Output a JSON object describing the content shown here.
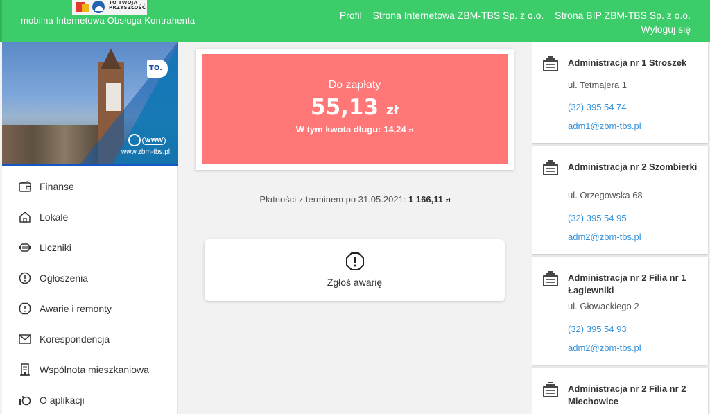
{
  "header": {
    "logo_line1": "TO TWOJA",
    "logo_line2": "PRZYSZŁOŚĆ",
    "subtitle": "mobilna Internetowa Obsługa Kontrahenta",
    "nav": {
      "profile": "Profil",
      "website": "Strona Internetowa ZBM-TBS Sp. z o.o.",
      "bip": "Strona BIP ZBM-TBS Sp. z o.o.",
      "logout": "Wyloguj się"
    }
  },
  "banner": {
    "badge": "TO.",
    "www_label": "WWW",
    "url": "www.zbm-tbs.pl"
  },
  "sidebar": {
    "items": [
      {
        "label": "Finanse",
        "icon": "wallet-icon"
      },
      {
        "label": "Lokale",
        "icon": "home-icon"
      },
      {
        "label": "Liczniki",
        "icon": "meter-icon"
      },
      {
        "label": "Ogłoszenia",
        "icon": "announcement-icon"
      },
      {
        "label": "Awarie i remonty",
        "icon": "alert-octagon-icon"
      },
      {
        "label": "Korespondencja",
        "icon": "envelope-icon"
      },
      {
        "label": "Wspólnota mieszkaniowa",
        "icon": "building-icon"
      },
      {
        "label": "O aplikacji",
        "icon": "info-icon"
      }
    ]
  },
  "payment": {
    "title": "Do zapłaty",
    "amount": "55,13",
    "currency": "zł",
    "debt_label": "W tym kwota długu: 14,24",
    "debt_currency": "zł"
  },
  "future_payments": {
    "label": "Płatności z terminem po 31.05.2021:",
    "amount": "1 166,11",
    "currency": "zł"
  },
  "report": {
    "label": "Zgłoś awarię",
    "icon": "alert-octagon-icon"
  },
  "administrations": [
    {
      "name": "Administracja nr 1 Stroszek",
      "address": "ul. Tetmajera 1",
      "phone": "(32) 395 54 74",
      "email": "adm1@zbm-tbs.pl"
    },
    {
      "name": "Administracja nr 2 Szombierki",
      "address": "ul. Orzegowska 68",
      "phone": "(32) 395 54 95",
      "email": "adm2@zbm-tbs.pl"
    },
    {
      "name": "Administracja nr 2 Filia nr 1 Łagiewniki",
      "address": "ul. Głowackiego 2",
      "phone": "(32) 395 54 93",
      "email": "adm2@zbm-tbs.pl"
    },
    {
      "name": "Administracja nr 2 Filia nr 2 Miechowice",
      "address": "",
      "phone": "",
      "email": ""
    }
  ],
  "colors": {
    "header": "#3dcc6a",
    "payment_box": "#ff7777",
    "link": "#3390d8",
    "banner_border": "#1257c4"
  }
}
